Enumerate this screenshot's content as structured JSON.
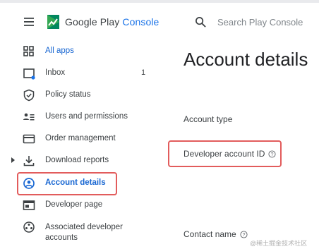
{
  "header": {
    "brand_google_play": "Google Play",
    "brand_console": "Console",
    "search_placeholder": "Search Play Console"
  },
  "sidebar": {
    "items": [
      {
        "label": "All apps"
      },
      {
        "label": "Inbox",
        "count": "1"
      },
      {
        "label": "Policy status"
      },
      {
        "label": "Users and permissions"
      },
      {
        "label": "Order management"
      },
      {
        "label": "Download reports"
      },
      {
        "label": "Account details"
      },
      {
        "label": "Developer page"
      },
      {
        "label": "Associated developer",
        "label2": "accounts"
      }
    ]
  },
  "main": {
    "title": "Account details",
    "fields": [
      {
        "label": "Account type"
      },
      {
        "label": "Developer account ID"
      },
      {
        "label": "Contact name"
      }
    ]
  },
  "watermark": "@稀土掘金技术社区",
  "colors": {
    "accent": "#1967d2",
    "highlight": "#e25c5c",
    "text": "#3c4043"
  }
}
